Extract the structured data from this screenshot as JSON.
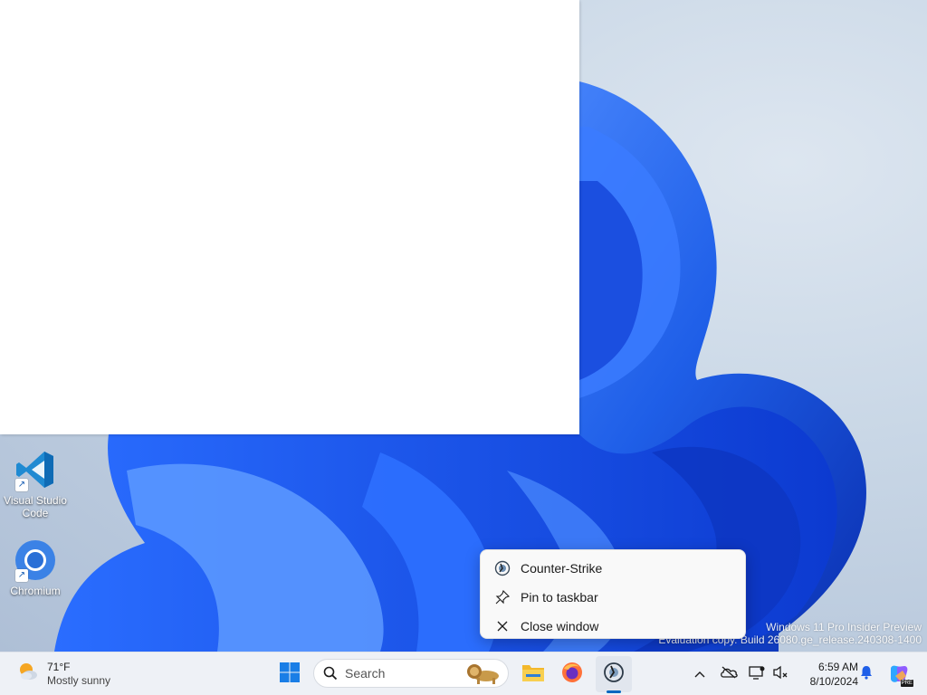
{
  "desktop": {
    "icons": [
      {
        "label": "Visual Studio Code",
        "icon": "vscode-icon"
      },
      {
        "label": "Chromium",
        "icon": "chromium-icon"
      }
    ],
    "watermark": {
      "line1": "Windows 11 Pro Insider Preview",
      "line2": "Evaluation copy. Build 26080.ge_release.240308-1400"
    }
  },
  "context_menu": {
    "items": [
      {
        "label": "Counter-Strike",
        "icon": "counter-strike-icon"
      },
      {
        "label": "Pin to taskbar",
        "icon": "pin-icon"
      },
      {
        "label": "Close window",
        "icon": "close-icon"
      }
    ]
  },
  "taskbar": {
    "weather": {
      "temp": "71°F",
      "condition": "Mostly sunny",
      "icon": "sun-cloud-icon"
    },
    "search": {
      "placeholder": "Search",
      "icon": "search-icon"
    },
    "apps": [
      "start-icon",
      "file-explorer-icon",
      "firefox-icon",
      "counter-strike-icon"
    ],
    "tray": [
      "chevron-up-icon",
      "onedrive-icon",
      "network-icon",
      "volume-icon",
      "notification-icon",
      "copilot-icon"
    ],
    "clock": {
      "time": "6:59 AM",
      "date": "8/10/2024"
    },
    "copilot_badge": "PRE"
  },
  "colors": {
    "accent": "#0067c0",
    "wallpaper_blue": "#1f5fe8",
    "taskbar_bg": "#eef1f6"
  }
}
